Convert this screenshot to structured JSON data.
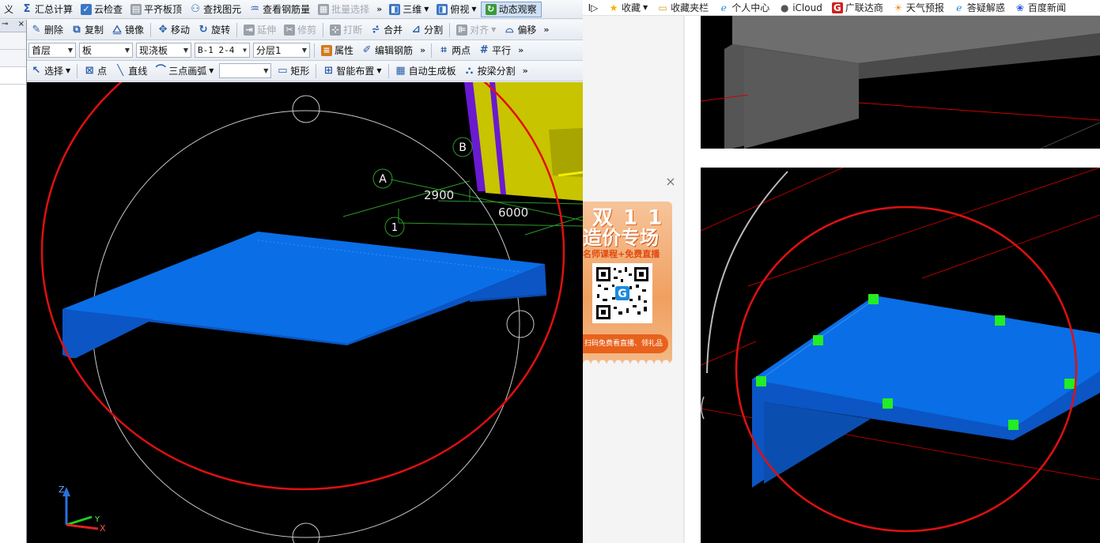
{
  "colors": {
    "slab_top": "#0a6ee6",
    "slab_side": "#0b55c4",
    "highlight_circle": "#e01010",
    "grip": "#22ee22",
    "wall_yellow": "#c8c400",
    "wall_purple": "#6a1ad0",
    "axis_green": "#2a9a2a"
  },
  "toolbar1": {
    "cut_label": "义",
    "sum_label": "汇总计算",
    "cloud_check_label": "云检查",
    "flush_top_label": "平齐板顶",
    "find_elem_label": "查找图元",
    "view_rebar_label": "查看钢筋量",
    "batch_select_label": "批量选择",
    "view3d_label": "三维",
    "topview_label": "俯视",
    "dynamic_label": "动态观察"
  },
  "toolbar2": {
    "delete_label": "删除",
    "copy_label": "复制",
    "mirror_label": "镜像",
    "move_label": "移动",
    "rotate_label": "旋转",
    "extend_label": "延伸",
    "trim_label": "修剪",
    "break_label": "打断",
    "merge_label": "合并",
    "split_label": "分割",
    "align_label": "对齐",
    "offset_label": "偏移"
  },
  "toolbar3": {
    "floor_value": "首层",
    "type_value": "板",
    "subtype_value": "现浇板",
    "name_value": "B-1 2-4",
    "layer_value": "分层1",
    "prop_label": "属性",
    "edit_rebar_label": "编辑钢筋",
    "two_points_label": "两点",
    "parallel_label": "平行"
  },
  "toolbar4": {
    "select_label": "选择",
    "point_label": "点",
    "line_label": "直线",
    "arc_label": "三点画弧",
    "rect_label": "矩形",
    "smart_layout_label": "智能布置",
    "auto_gen_label": "自动生成板",
    "split_beam_label": "按梁分割"
  },
  "viewport": {
    "axis_A": "A",
    "axis_B": "B",
    "axis_1": "1",
    "dim_2900": "2900",
    "dim_6000": "6000",
    "coord_z": "Z",
    "coord_x": "X",
    "coord_y": "Y"
  },
  "bookmarks": {
    "items": [
      {
        "label": "收藏"
      },
      {
        "label": "收藏夹栏"
      },
      {
        "label": "个人中心"
      },
      {
        "label": "iCloud"
      },
      {
        "label": "广联达商"
      },
      {
        "label": "天气预报"
      },
      {
        "label": "答疑解惑"
      },
      {
        "label": "百度新闻"
      }
    ]
  },
  "ad": {
    "line1": "双 1 1",
    "line2": "造价专场",
    "line3": "名师课程+免费直播",
    "line4": "扫码免费看直播、领礼品",
    "qr_logo": "G"
  }
}
